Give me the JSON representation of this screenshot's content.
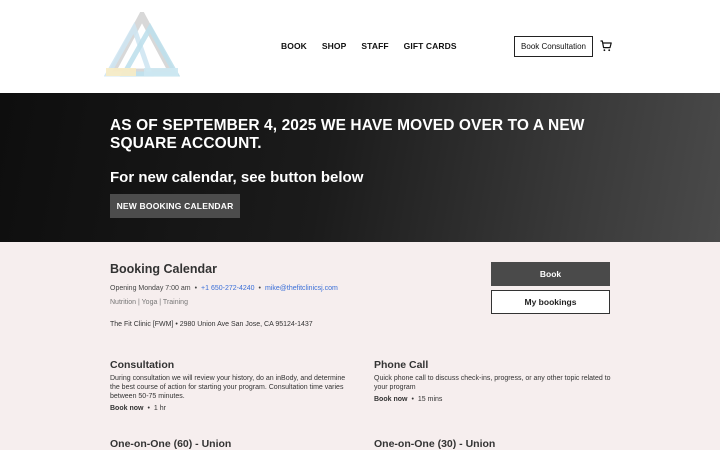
{
  "header": {
    "logo_icon": "triangle-logo-icon",
    "nav": [
      {
        "label": "BOOK"
      },
      {
        "label": "SHOP"
      },
      {
        "label": "STAFF"
      },
      {
        "label": "GIFT CARDS"
      }
    ],
    "consult_button": "Book Consultation",
    "cart_icon": "cart-icon"
  },
  "hero": {
    "title": "AS OF SEPTEMBER 4, 2025 WE HAVE MOVED OVER TO A NEW SQUARE ACCOUNT.",
    "subtitle": "For new calendar, see button below",
    "button": "NEW BOOKING CALENDAR"
  },
  "booking": {
    "title": "Booking Calendar",
    "opening": "Opening Monday 7:00 am",
    "phone": "+1 650-272-4240",
    "email": "mike@thefitclinicsj.com",
    "tags": "Nutrition | Yoga | Training",
    "address": "The Fit Clinic [FWM] • 2980 Union Ave San Jose, CA 95124-1437",
    "book_button": "Book",
    "my_bookings_button": "My bookings"
  },
  "services": [
    {
      "name": "Consultation",
      "description": "During consultation we will review your history, do an inBody, and determine the best course of action for starting your program. Consultation time varies between 50-75 minutes.",
      "book_now": "Book now",
      "duration": "1 hr"
    },
    {
      "name": "Phone Call",
      "description": "Quick phone call to discuss check-ins, progress, or any other topic related to your program",
      "book_now": "Book now",
      "duration": "15 mins"
    },
    {
      "name": "One-on-One (60) - Union"
    },
    {
      "name": "One-on-One (30) - Union"
    }
  ],
  "colors": {
    "background": "#f6eeee",
    "hero_dark": "#0e0e0e",
    "button_dark": "#4a4a4a",
    "link": "#3a6fd8"
  }
}
